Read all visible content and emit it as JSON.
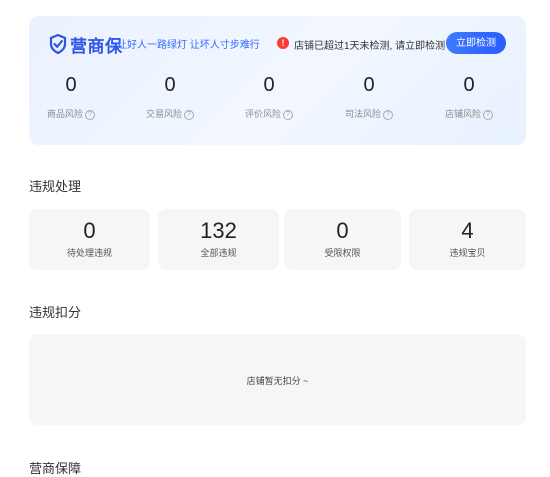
{
  "header": {
    "brand": "营商保",
    "slogan": "让好人一路绿灯 让坏人寸步难行",
    "alert_icon": "!",
    "alert_text": "店铺已超过1天未检测, 请立即检测",
    "check_button": "立即检测",
    "accent_color": "#2f54eb"
  },
  "risks": [
    {
      "value": "0",
      "label": "商品风险"
    },
    {
      "value": "0",
      "label": "交易风险"
    },
    {
      "value": "0",
      "label": "评价风险"
    },
    {
      "value": "0",
      "label": "司法风险"
    },
    {
      "value": "0",
      "label": "店铺风险"
    }
  ],
  "help_icon": "?",
  "violation": {
    "title": "违规处理",
    "cards": [
      {
        "value": "0",
        "label": "待处理违规"
      },
      {
        "value": "132",
        "label": "全部违规"
      },
      {
        "value": "0",
        "label": "受限权限"
      },
      {
        "value": "4",
        "label": "违规宝贝"
      }
    ]
  },
  "deduction": {
    "title": "违规扣分",
    "empty_text": "店铺暂无扣分 ~"
  },
  "next_section": {
    "title": "营商保障"
  }
}
